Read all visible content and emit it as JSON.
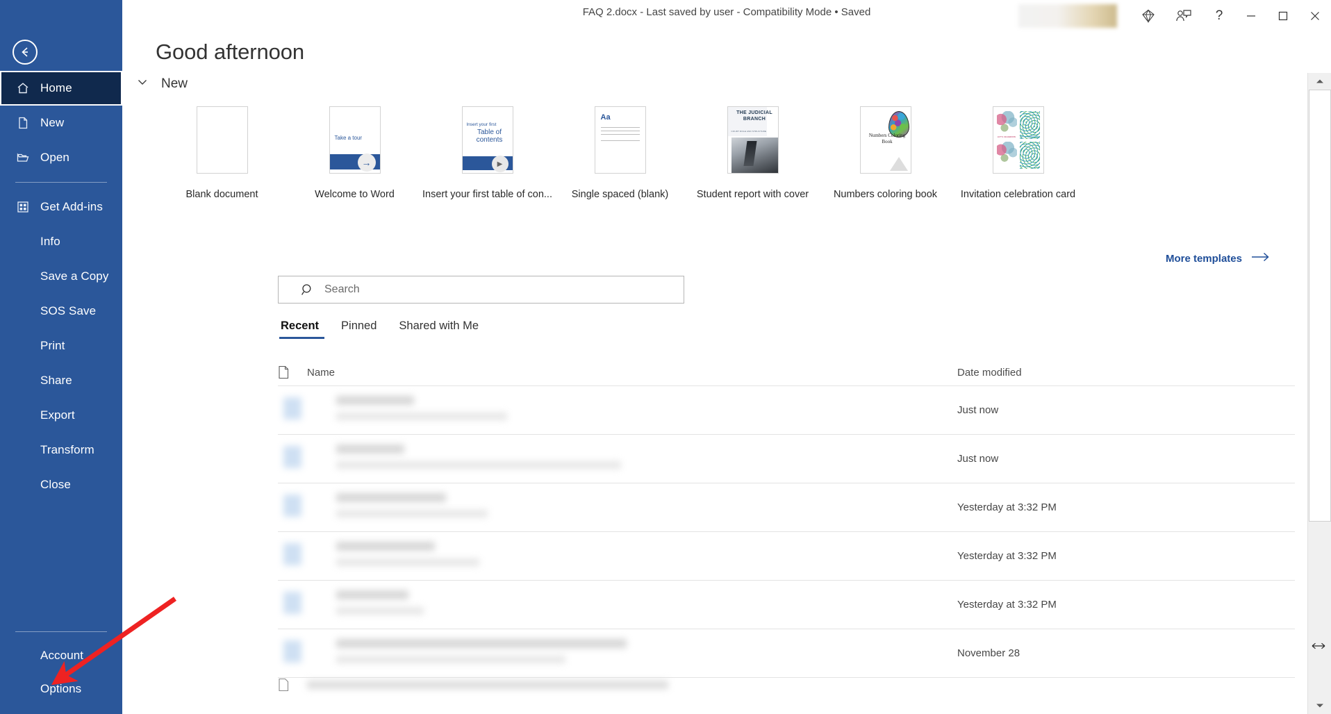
{
  "window": {
    "title": "FAQ 2.docx  -  Last saved by user  -  Compatibility Mode • Saved",
    "user_name_redacted": "",
    "controls": {
      "diamond_label": "",
      "share_label": "",
      "help_label": "?",
      "minimize_label": "",
      "maximize_label": "",
      "close_label": ""
    }
  },
  "sidebar": {
    "back_label": "",
    "items": [
      {
        "label": "Home",
        "icon": "home-icon",
        "selected": true
      },
      {
        "label": "New",
        "icon": "document-icon",
        "selected": false
      },
      {
        "label": "Open",
        "icon": "folder-open-icon",
        "selected": false
      },
      {
        "label": "Get Add-ins",
        "icon": "addins-grid-icon",
        "selected": false
      },
      {
        "label": "Info",
        "icon": "",
        "selected": false
      },
      {
        "label": "Save a Copy",
        "icon": "",
        "selected": false
      },
      {
        "label": "SOS Save",
        "icon": "",
        "selected": false
      },
      {
        "label": "Print",
        "icon": "",
        "selected": false
      },
      {
        "label": "Share",
        "icon": "",
        "selected": false
      },
      {
        "label": "Export",
        "icon": "",
        "selected": false
      },
      {
        "label": "Transform",
        "icon": "",
        "selected": false
      },
      {
        "label": "Close",
        "icon": "",
        "selected": false
      }
    ],
    "bottom_items": [
      {
        "label": "Account"
      },
      {
        "label": "Options"
      }
    ],
    "accent_color": "#2b579a",
    "selected_color": "#10294d"
  },
  "greeting": "Good afternoon",
  "new_section": {
    "heading": "New",
    "more_templates_label": "More templates",
    "templates": [
      {
        "name": "Blank document",
        "kind": "blank"
      },
      {
        "name": "Welcome to Word",
        "kind": "welcome",
        "thumb_text": "Take a tour"
      },
      {
        "name": "Insert your first table of con...",
        "kind": "toc",
        "thumb_line1": "Insert your first",
        "thumb_line2": "Table of contents"
      },
      {
        "name": "Single spaced (blank)",
        "kind": "single",
        "thumb_text": "Aa"
      },
      {
        "name": "Student report with cover",
        "kind": "judicial",
        "thumb_title": "THE JUDICIAL BRANCH",
        "thumb_sub": "COURT ROLE AND STRUCTURE"
      },
      {
        "name": "Numbers coloring book",
        "kind": "coloring",
        "thumb_text": "Numbers Coloring Book"
      },
      {
        "name": "Invitation celebration card",
        "kind": "invitation",
        "thumb_text": "LET'S CELEBRATE"
      }
    ]
  },
  "search": {
    "placeholder": "Search",
    "value": ""
  },
  "tabs": [
    {
      "label": "Recent",
      "active": true
    },
    {
      "label": "Pinned",
      "active": false
    },
    {
      "label": "Shared with Me",
      "active": false
    }
  ],
  "file_table": {
    "columns": {
      "name": "Name",
      "date_modified": "Date modified"
    },
    "rows": [
      {
        "name": "",
        "date_modified": "Just now",
        "redacted": true
      },
      {
        "name": "",
        "date_modified": "Just now",
        "redacted": true
      },
      {
        "name": "",
        "date_modified": "Yesterday at 3:32 PM",
        "redacted": true
      },
      {
        "name": "",
        "date_modified": "Yesterday at 3:32 PM",
        "redacted": true
      },
      {
        "name": "",
        "date_modified": "Yesterday at 3:32 PM",
        "redacted": true
      },
      {
        "name": "",
        "date_modified": "November 28",
        "redacted": true
      }
    ]
  },
  "annotation": {
    "type": "red-arrow",
    "points_to": "Options"
  }
}
